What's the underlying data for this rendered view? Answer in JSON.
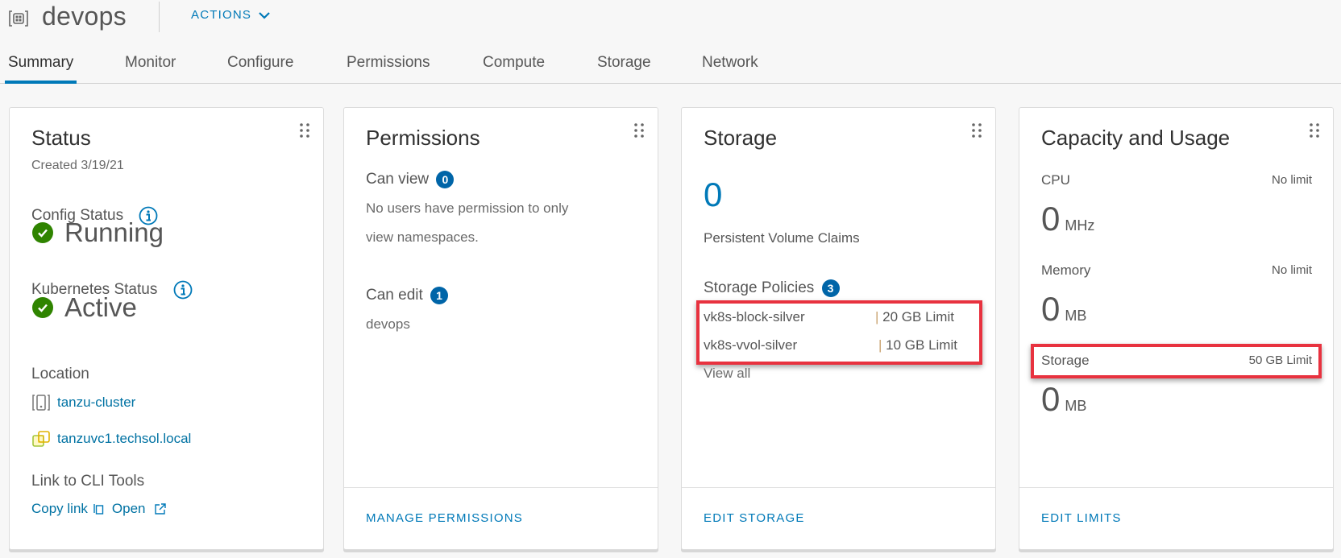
{
  "header": {
    "title": "devops",
    "title_icon": "namespace-icon",
    "actions_label": "ACTIONS"
  },
  "tabs": [
    {
      "label": "Summary",
      "active": true
    },
    {
      "label": "Monitor",
      "active": false
    },
    {
      "label": "Configure",
      "active": false
    },
    {
      "label": "Permissions",
      "active": false
    },
    {
      "label": "Compute",
      "active": false
    },
    {
      "label": "Storage",
      "active": false
    },
    {
      "label": "Network",
      "active": false
    }
  ],
  "status_card": {
    "title": "Status",
    "created": "Created 3/19/21",
    "config_status_label": "Config Status",
    "config_status_value": "Running",
    "k8s_status_label": "Kubernetes Status",
    "k8s_status_value": "Active",
    "location_label": "Location",
    "cluster_link": "tanzu-cluster",
    "vcenter_link": "tanzuvc1.techsol.local",
    "cli_label": "Link to CLI Tools",
    "copy_link": "Copy link",
    "open_link": "Open"
  },
  "permissions_card": {
    "title": "Permissions",
    "can_view_label": "Can view",
    "can_view_count": "0",
    "can_view_text_line1": "No users have permission to only",
    "can_view_text_line2": "view namespaces.",
    "can_edit_label": "Can edit",
    "can_edit_count": "1",
    "can_edit_user": "devops",
    "footer_button": "MANAGE PERMISSIONS"
  },
  "storage_card": {
    "title": "Storage",
    "pvc_count": "0",
    "pvc_label": "Persistent Volume Claims",
    "policies_label": "Storage Policies",
    "policies_count": "3",
    "policies": [
      {
        "name": "vk8s-block-silver",
        "limit": "20 GB Limit"
      },
      {
        "name": "vk8s-vvol-silver",
        "limit": "10 GB Limit"
      }
    ],
    "view_all": "View all",
    "footer_button": "EDIT STORAGE"
  },
  "capacity_card": {
    "title": "Capacity and Usage",
    "cpu_label": "CPU",
    "cpu_limit": "No limit",
    "cpu_value": "0",
    "cpu_unit": "MHz",
    "memory_label": "Memory",
    "memory_limit": "No limit",
    "memory_value": "0",
    "memory_unit": "MB",
    "storage_label": "Storage",
    "storage_limit": "50 GB Limit",
    "storage_value": "0",
    "storage_unit": "MB",
    "footer_button": "EDIT LIMITS"
  },
  "colors": {
    "accent": "#0079b8",
    "success": "#2f8400",
    "highlight": "#e8323f",
    "badge": "#0065a8"
  }
}
